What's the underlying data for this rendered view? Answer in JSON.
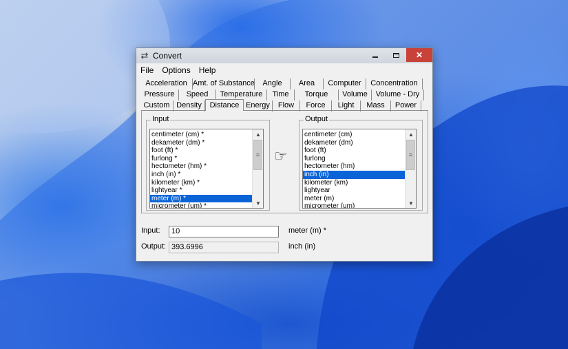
{
  "window": {
    "title": "Convert"
  },
  "menu": [
    "File",
    "Options",
    "Help"
  ],
  "tabs": {
    "row1": [
      "Acceleration",
      "Amt. of Substance",
      "Angle",
      "Area",
      "Computer",
      "Concentration"
    ],
    "row2": [
      "Pressure",
      "Speed",
      "Temperature",
      "Time",
      "Torque",
      "Volume",
      "Volume - Dry"
    ],
    "row3": [
      "Custom",
      "Density",
      "Distance",
      "Energy",
      "Flow",
      "Force",
      "Light",
      "Mass",
      "Power"
    ],
    "active": "Distance"
  },
  "input_group": {
    "label": "Input",
    "items": [
      "centimeter (cm) *",
      "dekameter (dm) *",
      "foot (ft) *",
      "furlong *",
      "hectometer (hm) *",
      "inch (in) *",
      "kilometer (km) *",
      "lightyear *",
      "meter (m) *",
      "micrometer (um) *"
    ],
    "selected": "meter (m) *"
  },
  "output_group": {
    "label": "Output",
    "items": [
      "centimeter (cm)",
      "dekameter (dm)",
      "foot (ft)",
      "furlong",
      "hectometer (hm)",
      "inch (in)",
      "kilometer (km)",
      "lightyear",
      "meter (m)",
      "micrometer (um)"
    ],
    "selected": "inch (in)"
  },
  "fields": {
    "input_label": "Input:",
    "input_value": "10",
    "input_unit": "meter (m) *",
    "output_label": "Output:",
    "output_value": "393.6996",
    "output_unit": "inch (in)"
  },
  "icons": {
    "app": "convert-icon",
    "pointer": "pointing-hand-icon",
    "scroll_up": "chevron-up-icon",
    "scroll_down": "chevron-down-icon",
    "grip": "scroll-grip-icon"
  },
  "colors": {
    "selection": "#0a64d8",
    "close_button": "#c9423a",
    "window_bg": "#f0f0f0"
  }
}
